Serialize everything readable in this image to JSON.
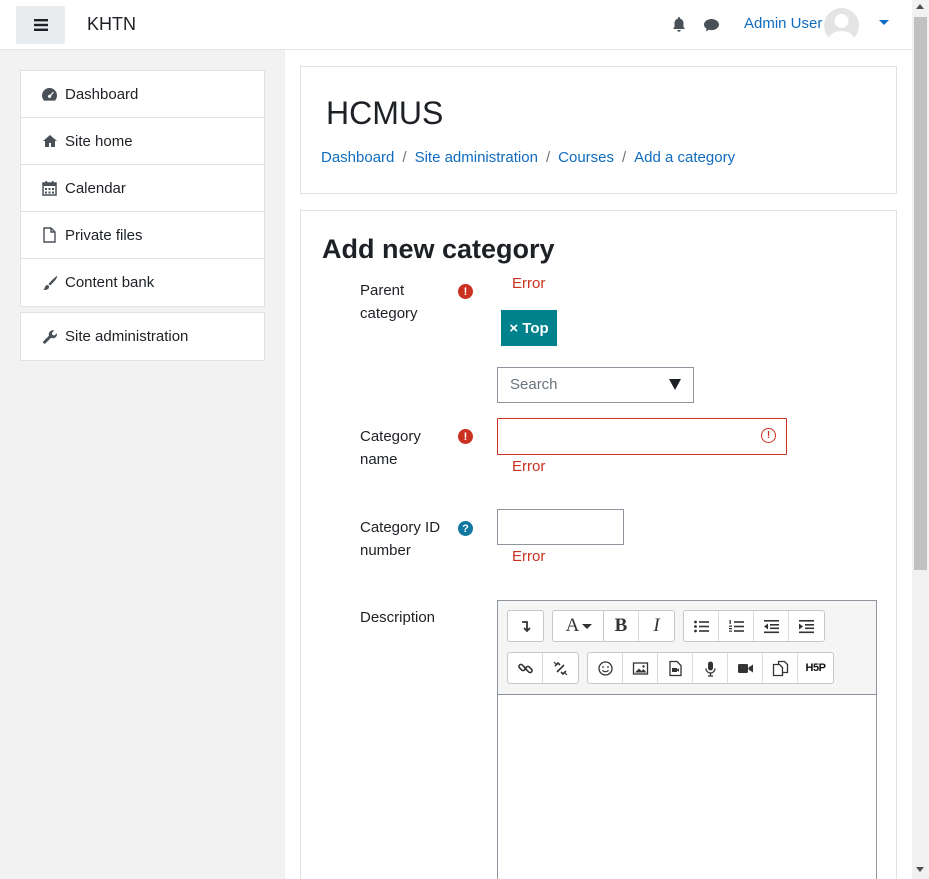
{
  "navbar": {
    "brand": "KHTN",
    "user_name": "Admin User"
  },
  "sidebar": {
    "items": [
      {
        "label": "Dashboard",
        "icon": "dashboard-icon"
      },
      {
        "label": "Site home",
        "icon": "home-icon"
      },
      {
        "label": "Calendar",
        "icon": "calendar-icon"
      },
      {
        "label": "Private files",
        "icon": "file-icon"
      },
      {
        "label": "Content bank",
        "icon": "brush-icon"
      }
    ],
    "admin": {
      "label": "Site administration",
      "icon": "wrench-icon"
    }
  },
  "header": {
    "title": "HCMUS",
    "breadcrumb": [
      "Dashboard",
      "Site administration",
      "Courses",
      "Add a category"
    ]
  },
  "form": {
    "title": "Add new category",
    "parent_label_1": "Parent",
    "parent_label_2": "category",
    "parent_error": "Error",
    "selected_tag": "× Top",
    "search_placeholder": "Search",
    "name_label_1": "Category",
    "name_label_2": "name",
    "name_error": "Error",
    "id_label_1": "Category ID",
    "id_label_2": "number",
    "id_error": "Error",
    "description_label": "Description",
    "name_value": "",
    "id_value": ""
  },
  "editor": {
    "row1": [
      [
        "collapse-icon"
      ],
      [
        "font-style-icon"
      ],
      [
        "bold-icon",
        "italic-icon"
      ],
      [
        "bullet-list-icon",
        "numbered-list-icon",
        "outdent-icon",
        "indent-icon"
      ]
    ],
    "row2": [
      [
        "link-icon",
        "unlink-icon"
      ],
      [
        "emoji-icon",
        "image-icon",
        "media-icon",
        "audio-icon",
        "video-icon",
        "manage-files-icon",
        "h5p-icon"
      ]
    ],
    "bold_glyph": "B",
    "italic_glyph": "I",
    "font_glyph": "A",
    "h5p_glyph": "H5P"
  },
  "colors": {
    "accent": "#0f6cbf",
    "error": "#ca3120",
    "tag": "#00828c"
  }
}
